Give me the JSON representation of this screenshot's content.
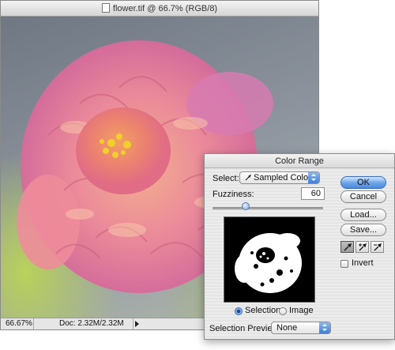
{
  "document_window": {
    "title": "flower.tif @ 66.7% (RGB/8)",
    "file_icon": "document-icon",
    "status": {
      "zoom": "66.67%",
      "doc_size": "Doc: 2.32M/2.32M",
      "menu_arrow_icon": "triangle-right-icon"
    }
  },
  "dialog": {
    "title": "Color Range",
    "select_label": "Select:",
    "select_value": "Sampled Colors",
    "select_icon": "eyedropper-icon",
    "fuzziness_label": "Fuzziness:",
    "fuzziness_value": "60",
    "fuzziness_level": 0.3,
    "radio_selection": "Selection",
    "radio_image": "Image",
    "selected_view": "Selection",
    "selection_preview_label": "Selection Preview:",
    "selection_preview_value": "None",
    "buttons": {
      "ok": "OK",
      "cancel": "Cancel",
      "load": "Load...",
      "save": "Save..."
    },
    "tools": [
      "eyedropper-icon",
      "eyedropper-plus-icon",
      "eyedropper-minus-icon"
    ],
    "invert_label": "Invert",
    "invert_checked": false
  },
  "colors": {
    "default_button": "#4b8ce0",
    "petal_pink": "#f08a9a",
    "petal_peach": "#f6a680",
    "center_yellow": "#f1d02a"
  }
}
